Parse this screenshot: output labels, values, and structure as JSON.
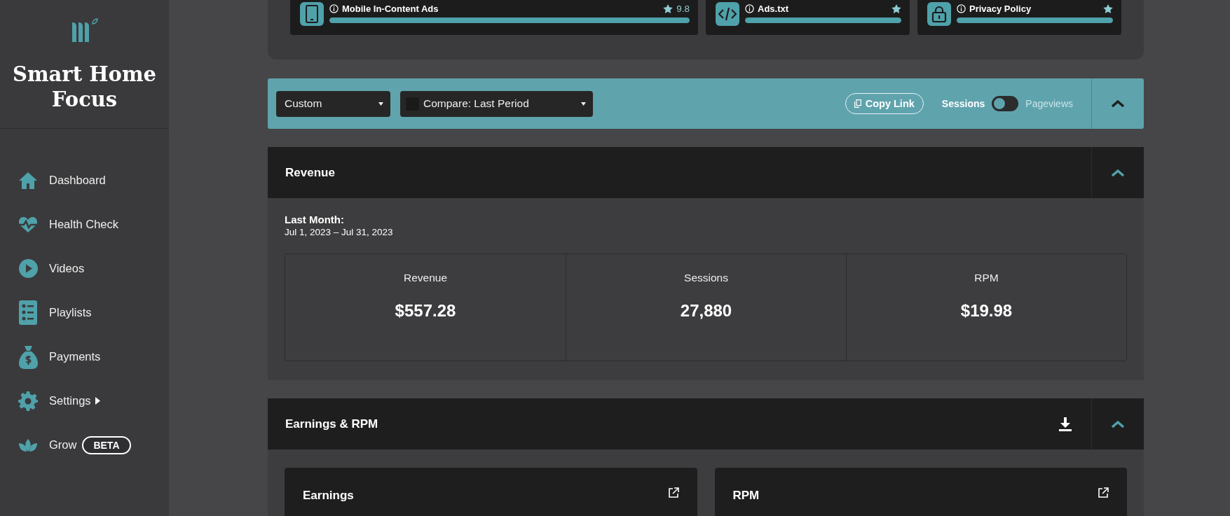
{
  "sidebar": {
    "brand": "Smart Home Focus",
    "items": [
      {
        "label": "Dashboard"
      },
      {
        "label": "Health Check"
      },
      {
        "label": "Videos"
      },
      {
        "label": "Playlists"
      },
      {
        "label": "Payments"
      },
      {
        "label": "Settings",
        "has_submenu": true
      },
      {
        "label": "Grow",
        "badge": "BETA"
      }
    ]
  },
  "health_cards": [
    {
      "title": "Mobile In-Content Ads",
      "level": 1,
      "score": "9.8"
    },
    {
      "title": "Ads.txt",
      "level": 1
    },
    {
      "title": "Privacy Policy",
      "level": 1
    }
  ],
  "filter_bar": {
    "date_range": "Custom",
    "compare": {
      "checked": false,
      "label": "Compare: Last Period"
    },
    "copy_link": "Copy Link",
    "metric_toggle": {
      "left_label": "Sessions",
      "right_label": "Pageviews",
      "on": false
    },
    "expanded": true
  },
  "revenue": {
    "title": "Revenue",
    "expanded": true,
    "period_label": "Last Month:",
    "period": "Jul 1, 2023 – Jul 31, 2023",
    "stats": [
      {
        "label": "Revenue",
        "value": "$557.28"
      },
      {
        "label": "Sessions",
        "value": "27,880"
      },
      {
        "label": "RPM",
        "value": "$19.98"
      }
    ]
  },
  "earnings_rpm": {
    "title": "Earnings & RPM",
    "expanded": true,
    "cards": [
      {
        "title": "Earnings"
      },
      {
        "title": "RPM"
      }
    ]
  }
}
